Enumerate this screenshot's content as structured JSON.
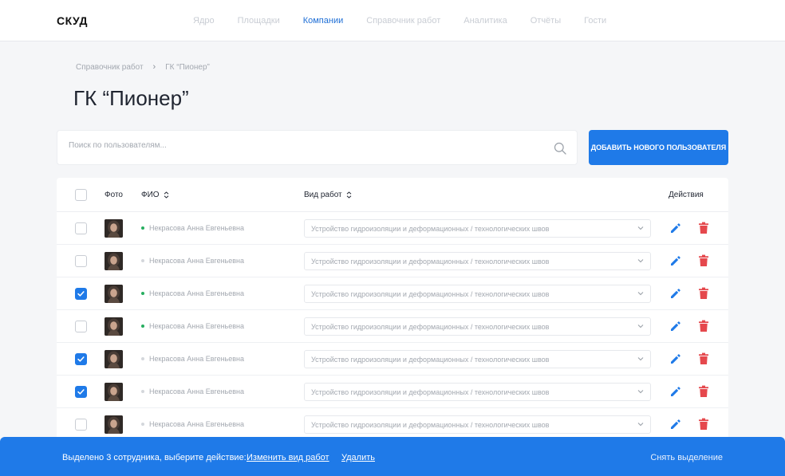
{
  "app": {
    "logo": "СКУД"
  },
  "nav": {
    "items": [
      "Ядро",
      "Площадки",
      "Компании",
      "Справочник работ",
      "Аналитика",
      "Отчёты",
      "Гости"
    ],
    "active": "Компании"
  },
  "breadcrumb": {
    "parent": "Справочник работ",
    "separator": "›",
    "current": "ГК “Пионер”"
  },
  "page": {
    "title": "ГК “Пионер”"
  },
  "search": {
    "placeholder": "Поиск по пользователям...",
    "value": ""
  },
  "add_button": {
    "label": "Добавить нового пользователя"
  },
  "table": {
    "headers": {
      "photo": "Фото",
      "fio": "ФИО",
      "work_type": "Вид работ",
      "actions": "Действия"
    },
    "rows": [
      {
        "checked": false,
        "online": true,
        "name": "Некрасова Анна Евгеньевна",
        "work_type": "Устройство гидроизоляции и деформационных / технологических швов"
      },
      {
        "checked": false,
        "online": false,
        "name": "Некрасова Анна Евгеньевна",
        "work_type": "Устройство гидроизоляции и деформационных / технологических швов"
      },
      {
        "checked": true,
        "online": true,
        "name": "Некрасова Анна Евгеньевна",
        "work_type": "Устройство гидроизоляции и деформационных / технологических швов"
      },
      {
        "checked": false,
        "online": true,
        "name": "Некрасова Анна Евгеньевна",
        "work_type": "Устройство гидроизоляции и деформационных / технологических швов"
      },
      {
        "checked": true,
        "online": false,
        "name": "Некрасова Анна Евгеньевна",
        "work_type": "Устройство гидроизоляции и деформационных / технологических швов"
      },
      {
        "checked": true,
        "online": false,
        "name": "Некрасова Анна Евгеньевна",
        "work_type": "Устройство гидроизоляции и деформационных / технологических швов"
      },
      {
        "checked": false,
        "online": false,
        "name": "Некрасова Анна Евгеньевна",
        "work_type": "Устройство гидроизоляции и деформационных / технологических швов"
      }
    ]
  },
  "bottom_bar": {
    "message": "Выделено 3 сотрудника, выберите действие:",
    "change_work_type": "Изменить вид работ",
    "delete": "Удалить",
    "clear_selection": "Снять выделение"
  },
  "colors": {
    "accent": "#1f7ae8",
    "online": "#27ae60",
    "danger": "#e5484d"
  },
  "icons": {
    "search": "search-icon",
    "edit": "pencil-icon",
    "delete": "trash-icon",
    "sort": "sort-icon",
    "chevron": "chevron-down-icon"
  }
}
